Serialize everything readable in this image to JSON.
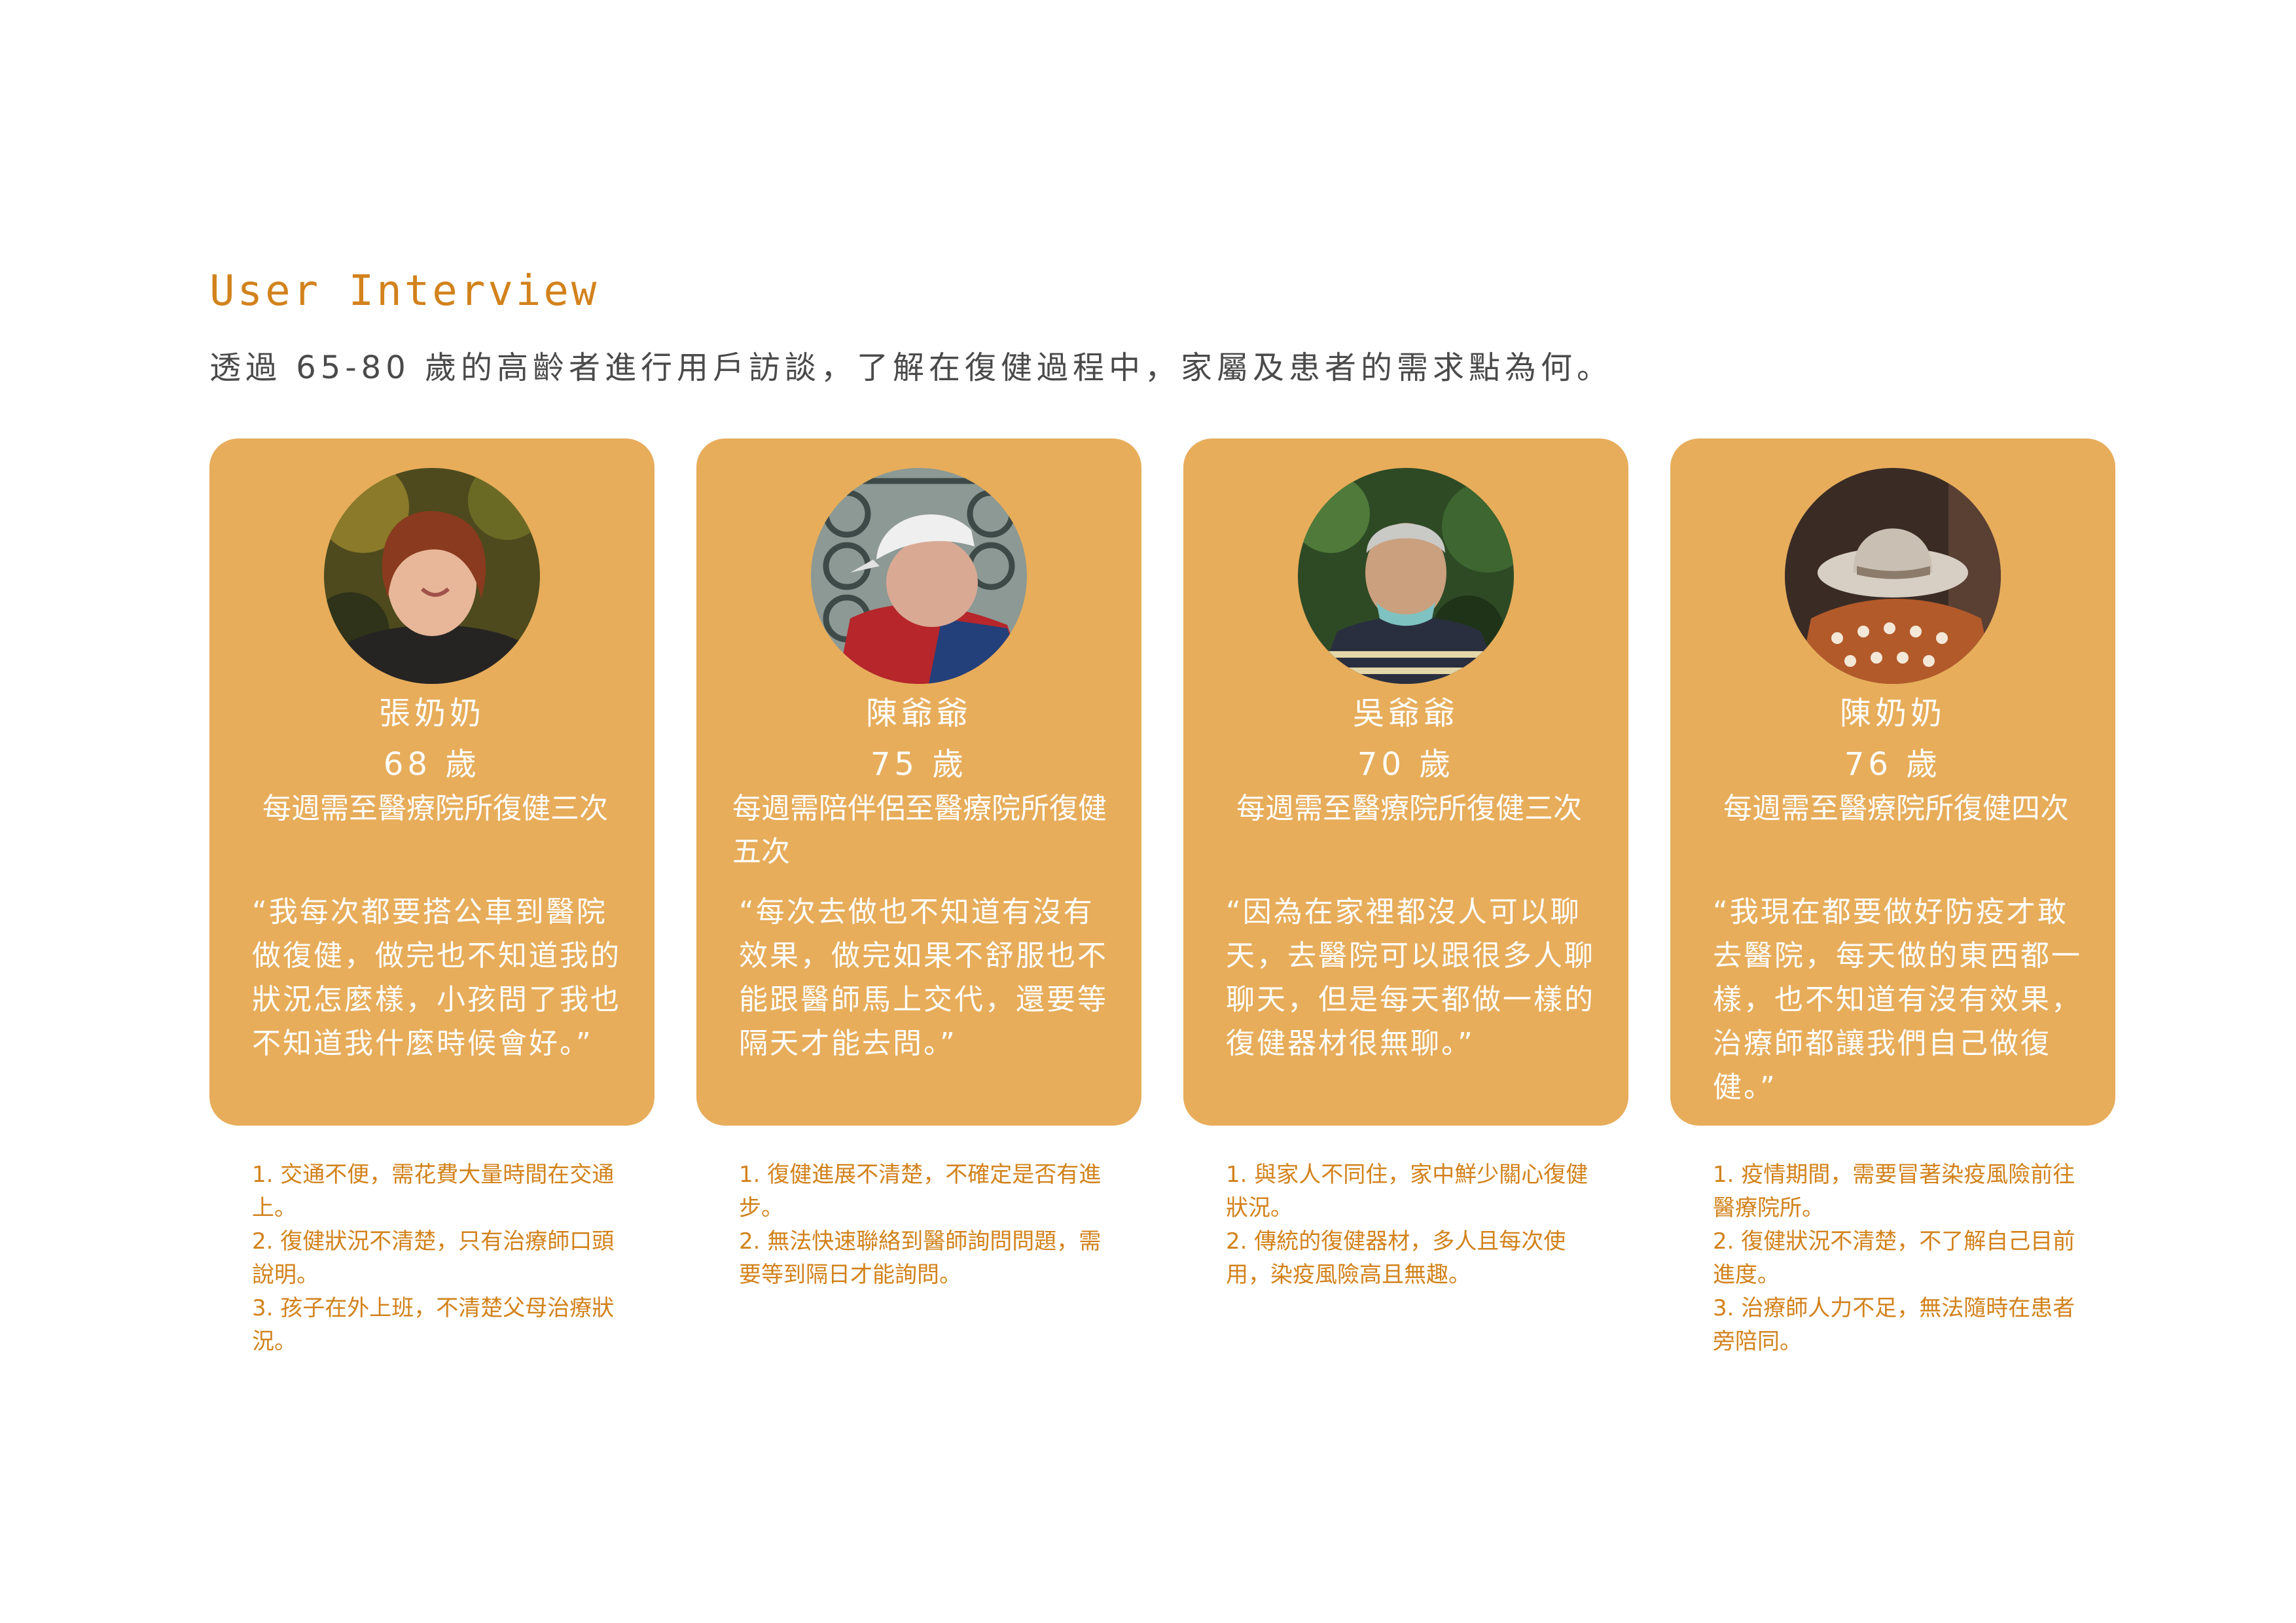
{
  "header": {
    "title": "User Interview",
    "subtitle": "透過 65-80 歲的高齡者進行用戶訪談，了解在復健過程中，家屬及患者的需求點為何。"
  },
  "colors": {
    "accent": "#d2821c",
    "card": "#e7ad5b",
    "subtitle": "#4a4a4a"
  },
  "personas": [
    {
      "name": "張奶奶",
      "age": "68 歲",
      "frequency": "每週需至醫療院所復健三次",
      "quote": "“我每次都要搭公車到醫院做復健，做完也不知道我的狀況怎麼樣，小孩問了我也不知道我什麼時候會好。”",
      "pain_points": [
        "1. 交通不便，需花費大量時間在交通上。",
        "2. 復健狀況不清楚，只有治療師口頭說明。",
        "3. 孩子在外上班，不清楚父母治療狀況。"
      ]
    },
    {
      "name": "陳爺爺",
      "age": "75 歲",
      "frequency": "每週需陪伴侶至醫療院所復健五次",
      "quote": "“每次去做也不知道有沒有效果，做完如果不舒服也不能跟醫師馬上交代，還要等隔天才能去問。”",
      "pain_points": [
        "1. 復健進展不清楚，不確定是否有進步。",
        "2. 無法快速聯絡到醫師詢問問題，需要等到隔日才能詢問。"
      ]
    },
    {
      "name": "吳爺爺",
      "age": "70 歲",
      "frequency": "每週需至醫療院所復健三次",
      "quote": "“因為在家裡都沒人可以聊天，去醫院可以跟很多人聊聊天，但是每天都做一樣的復健器材很無聊。”",
      "pain_points": [
        "1. 與家人不同住，家中鮮少關心復健狀況。",
        "2. 傳統的復健器材，多人且每次使用，染疫風險高且無趣。"
      ]
    },
    {
      "name": "陳奶奶",
      "age": "76 歲",
      "frequency": "每週需至醫療院所復健四次",
      "quote": "“我現在都要做好防疫才敢去醫院，每天做的東西都一樣，也不知道有沒有效果，治療師都讓我們自己做復健。”",
      "pain_points": [
        "1. 疫情期間，需要冒著染疫風險前往醫療院所。",
        "2. 復健狀況不清楚，不了解自己目前進度。",
        "3. 治療師人力不足，無法隨時在患者旁陪同。"
      ]
    }
  ]
}
